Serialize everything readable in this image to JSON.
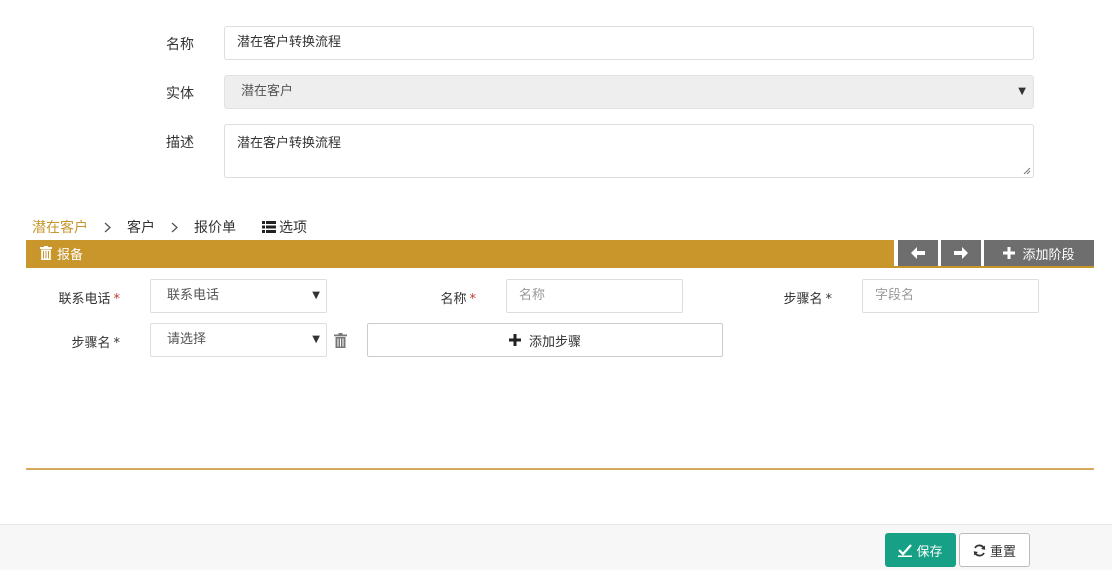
{
  "form": {
    "name_label": "名称",
    "name_value": "潜在客户转换流程",
    "entity_label": "实体",
    "entity_value": "潜在客户",
    "description_label": "描述",
    "description_value": "潜在客户转换流程"
  },
  "breadcrumb": {
    "items": [
      "潜在客户",
      "客户",
      "报价单"
    ],
    "options_label": "选项"
  },
  "stage": {
    "title": "报备",
    "color": "#c9962c",
    "add_stage_label": "添加阶段"
  },
  "fields": {
    "phone_label": "联系电话",
    "phone_value": "联系电话",
    "name_label": "名称",
    "name_placeholder": "名称",
    "step_label": "步骤名",
    "step_placeholder": "字段名",
    "step2_label": "步骤名",
    "step2_value": "请选择",
    "required_mark": "*",
    "add_step_label": "添加步骤"
  },
  "footer": {
    "save_label": "保存",
    "reset_label": "重置",
    "save_color": "#16a085"
  },
  "icons": {
    "dropdown": "caret-down-icon",
    "trash": "trash-icon",
    "left": "arrow-left-icon",
    "right": "arrow-right-icon",
    "plus": "plus-icon",
    "list": "list-icon",
    "check": "check-icon",
    "refresh": "refresh-icon",
    "chevron": "chevron-right-icon"
  }
}
